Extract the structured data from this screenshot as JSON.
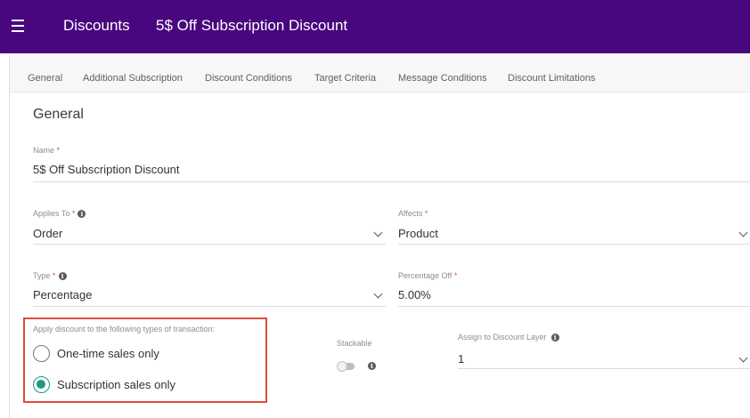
{
  "header": {
    "menu_icon": "hamburger-menu-icon",
    "section": "Discounts",
    "page_title": "5$ Off Subscription Discount",
    "bg_color": "#49077f"
  },
  "tabs": [
    {
      "label": "General"
    },
    {
      "label": "Additional Subscription"
    },
    {
      "label": "Discount Conditions"
    },
    {
      "label": "Target Criteria"
    },
    {
      "label": "Message Conditions"
    },
    {
      "label": "Discount Limitations"
    }
  ],
  "form": {
    "section_title": "General",
    "required_mark": "*",
    "info_glyph": "i",
    "name": {
      "label": "Name",
      "value": "5$ Off Subscription Discount"
    },
    "applies_to": {
      "label": "Applies To",
      "value": "Order"
    },
    "affects": {
      "label": "Affects",
      "value": "Product"
    },
    "type": {
      "label": "Type",
      "value": "Percentage"
    },
    "percentage_off": {
      "label": "Percentage Off",
      "value": "5.00%"
    },
    "transaction_types": {
      "label": "Apply discount to the following types of transaction:",
      "options": [
        {
          "label": "One-time sales only",
          "checked": false
        },
        {
          "label": "Subscription sales only",
          "checked": true
        }
      ]
    },
    "stackable": {
      "label": "Stackable",
      "enabled": false
    },
    "discount_layer": {
      "label": "Assign to Discount Layer",
      "value": "1"
    }
  },
  "colors": {
    "accent_teal": "#199a88",
    "highlight_border": "#e04a3e",
    "required_red": "#e55050"
  }
}
